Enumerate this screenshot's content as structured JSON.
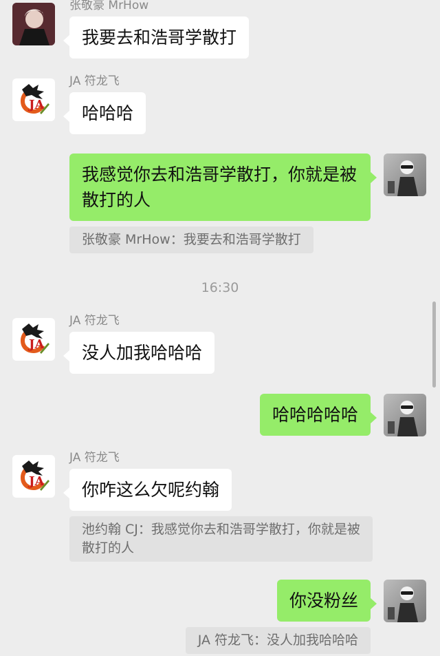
{
  "colors": {
    "background": "#ededed",
    "incoming_bubble": "#ffffff",
    "outgoing_bubble": "#95ec69",
    "quote_background": "#e1e1e1"
  },
  "messages": [
    {
      "sender": "张敬豪 MrHow",
      "text": "我要去和浩哥学散打",
      "avatar": "user-avatar-mrhow"
    },
    {
      "sender": "JA 符龙飞",
      "text": "哈哈哈",
      "avatar": "ja-dragon-logo"
    },
    {
      "text": "我感觉你去和浩哥学散打，你就是被散打的人",
      "avatar": "self-avatar"
    },
    {
      "quote": "张敬豪 MrHow：我要去和浩哥学散打"
    },
    {
      "time": "16:30"
    },
    {
      "sender": "JA 符龙飞",
      "text": "没人加我哈哈哈",
      "avatar": "ja-dragon-logo"
    },
    {
      "text": "哈哈哈哈哈",
      "avatar": "self-avatar"
    },
    {
      "sender": "JA 符龙飞",
      "text": "你咋这么欠呢约翰",
      "avatar": "ja-dragon-logo"
    },
    {
      "quote": "池约翰 CJ：我感觉你去和浩哥学散打，你就是被散打的人"
    },
    {
      "text": "你没粉丝",
      "avatar": "self-avatar"
    },
    {
      "quote": "JA 符龙飞：没人加我哈哈哈"
    }
  ]
}
